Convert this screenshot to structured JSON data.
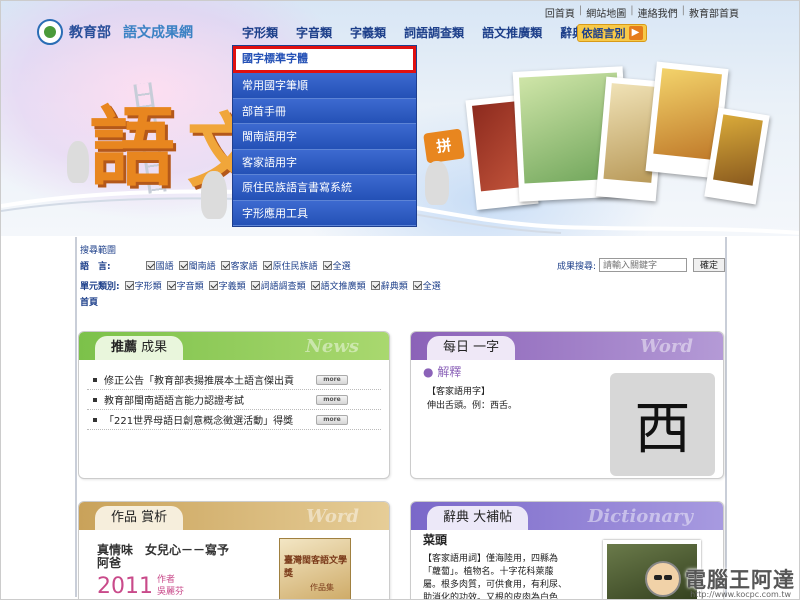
{
  "header": {
    "logo_text1": "教育部",
    "logo_text2": "語文成果網",
    "top_links": [
      "回首頁",
      "網站地圖",
      "連絡我們",
      "教育部首頁"
    ],
    "top_links_sep": "|"
  },
  "mainnav": {
    "items": [
      "字形類",
      "字音類",
      "字義類",
      "詞語調查類",
      "語文推廣類",
      "辭典類"
    ],
    "lang_button": "依語言別"
  },
  "dropdown": {
    "items": [
      "國字標準字體",
      "常用國字筆順",
      "部首手冊",
      "閩南語用字",
      "客家語用字",
      "原住民族語言書寫系統",
      "字形應用工具"
    ]
  },
  "banner": {
    "char1": "語",
    "char2": "文",
    "sign": "拼"
  },
  "search": {
    "scope_title": "搜尋範圍",
    "lang_label": "語　言:",
    "lang_options": [
      "國語",
      "閩南語",
      "客家語",
      "原住民族語",
      "全選"
    ],
    "unit_label": "單元類別:",
    "unit_options": [
      "字形類",
      "字音類",
      "字義類",
      "詞語調查類",
      "語文推廣類",
      "辭典類",
      "全選"
    ],
    "home": "首頁",
    "query_label": "成果搜尋:",
    "query_placeholder": "請輸入關鍵字",
    "submit": "確定"
  },
  "panels": {
    "recommend": {
      "title_a": "推薦",
      "title_b": "成果",
      "bg_word": "News",
      "items": [
        "修正公告「教育部表揚推展本土語言傑出貢",
        "教育部閩南語語言能力認證考試",
        "「221世界母語日創意概念徵選活動」得獎"
      ],
      "more": "more"
    },
    "daily": {
      "title_a": "每日",
      "title_b": "一字",
      "bg_word": "Word",
      "heading": "解釋",
      "source": "【客家語用字】",
      "definition": "伸出舌頭。例：西舌。",
      "character": "西"
    },
    "works": {
      "title_a": "作品",
      "title_b": "賞析",
      "bg_word": "Word",
      "headline": "真情味　女兒心－－寫予",
      "headline2": "阿爸",
      "year": "2011",
      "author_label": "作者",
      "author": "吳麗芬",
      "book_title": "臺灣閩客語文學獎",
      "book_sub": "作品集"
    },
    "dictionary": {
      "title_a": "辭典",
      "title_b": "大補帖",
      "bg_word": "Dictionary",
      "term": "菜頭",
      "text_lines": [
        "【客家語用詞】僅海陸用，四縣為",
        "「蘿蔔」。植物名。十字花科萊菔",
        "屬。根多肉質，可供食用，有利尿、",
        "助消化的功效。又根的皮肉為白色"
      ]
    }
  },
  "watermark": {
    "text": "電腦王阿達",
    "url": "http://www.kocpc.com.tw"
  },
  "colors": {
    "nav_text": "#1d3f8a",
    "dropdown_bg": "#2a55b8",
    "dropdown_highlight_border": "#e01010",
    "recommend_bar": "#7cc14a",
    "daily_bar": "#8b62b8",
    "works_bar": "#c9a25a",
    "dictionary_bar": "#7a68c9"
  }
}
